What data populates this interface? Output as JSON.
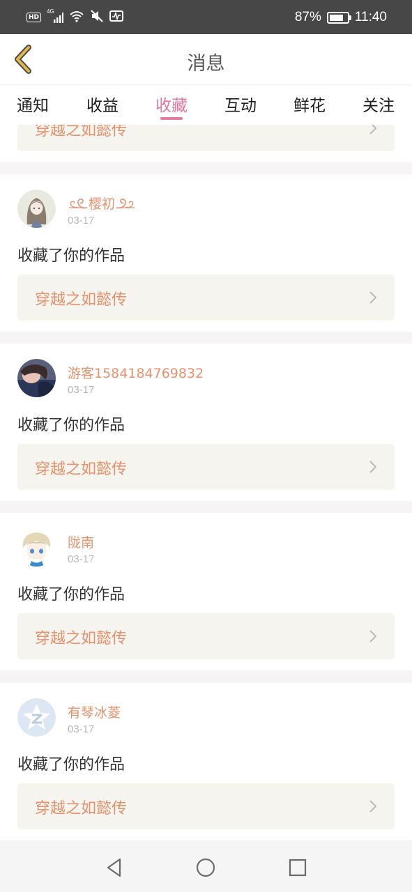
{
  "status_bar": {
    "left_icons": [
      "hd-badge",
      "4g-signal-icon",
      "wifi-icon",
      "mute-icon",
      "activity-icon"
    ],
    "hd_label": "HD",
    "network_label": "4G",
    "battery_percent": "87%",
    "battery_level": 0.87,
    "time": "11:40"
  },
  "header": {
    "title": "消息",
    "back_icon": "chevron-left-icon",
    "back_color": "#e0b84a"
  },
  "tabs": [
    {
      "label": "通知",
      "active": false
    },
    {
      "label": "收益",
      "active": false
    },
    {
      "label": "收藏",
      "active": true
    },
    {
      "label": "互动",
      "active": false
    },
    {
      "label": "鲜花",
      "active": false
    },
    {
      "label": "关注",
      "active": false
    }
  ],
  "colors": {
    "accent": "#e27aa2",
    "username": "#e4926e",
    "work_title": "#e4926e",
    "work_box_bg": "#f5f4ee",
    "separator": "#f6f4f4"
  },
  "partial_top_card": {
    "work_title": "穿越之如懿传"
  },
  "items": [
    {
      "username": "樱初",
      "decorated_name": true,
      "date": "03-17",
      "action": "收藏了你的作品",
      "work_title": "穿越之如懿传",
      "avatar": "anime-girl-avatar"
    },
    {
      "username": "游客1584184769832",
      "decorated_name": false,
      "date": "03-17",
      "action": "收藏了你的作品",
      "work_title": "穿越之如懿传",
      "avatar": "photo-avatar"
    },
    {
      "username": "陇南",
      "decorated_name": false,
      "date": "03-17",
      "action": "收藏了你的作品",
      "work_title": "穿越之如懿传",
      "avatar": "anime-boy-avatar"
    },
    {
      "username": "有琴冰菱",
      "decorated_name": false,
      "date": "03-17",
      "action": "收藏了你的作品",
      "work_title": "穿越之如懿传",
      "avatar": "default-star-avatar"
    }
  ],
  "nav_bar": {
    "buttons": [
      "back-triangle-icon",
      "home-circle-icon",
      "recents-square-icon"
    ]
  }
}
